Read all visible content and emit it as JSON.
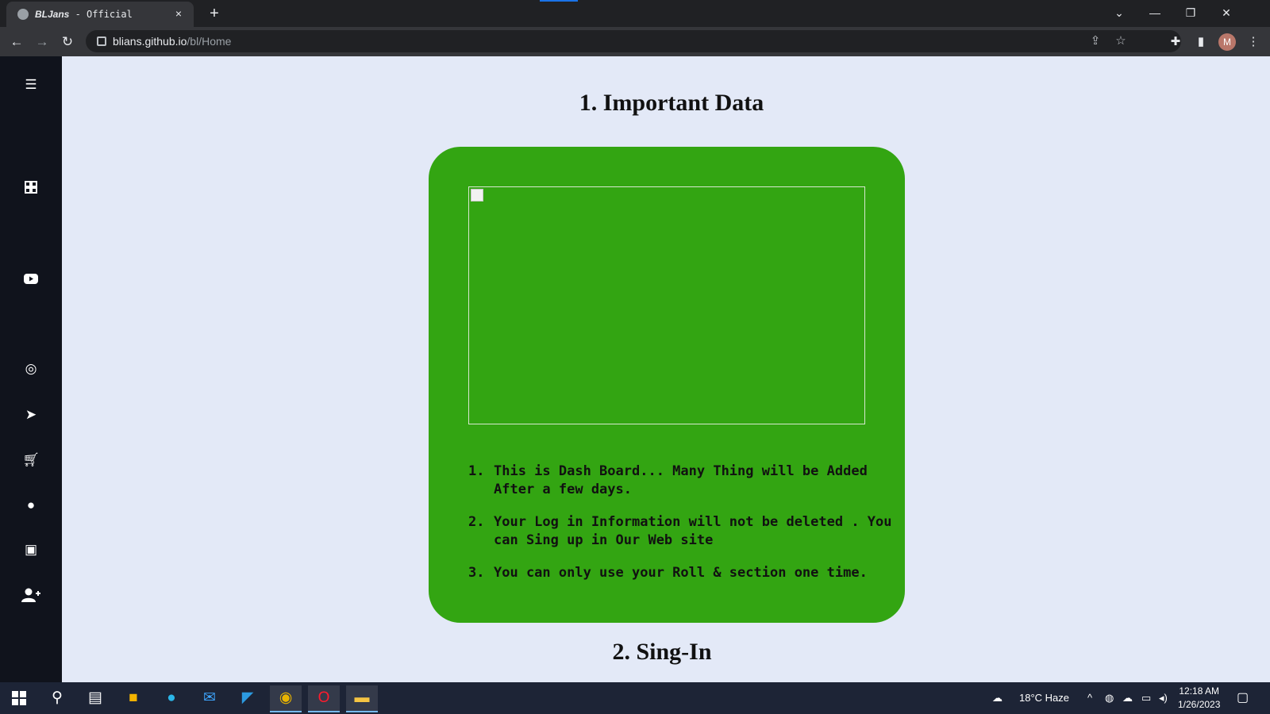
{
  "browser": {
    "tab": {
      "title_bold": "BLJans",
      "title_rest": " - Official",
      "close_label": "×"
    },
    "new_tab_label": "+",
    "url": {
      "host": "blians.github.io",
      "path": "/bl/Home"
    },
    "profile_initial": "M",
    "window_controls": [
      "⌄",
      "—",
      "❐",
      "✕"
    ]
  },
  "sidebar": {
    "icons": [
      "menu-icon",
      "grid-icon",
      "youtube-icon",
      "whatsapp-icon",
      "telegram-icon",
      "cart-icon",
      "bug-icon",
      "contact-icon",
      "add-user-icon"
    ]
  },
  "main": {
    "section1_title": "1. Important Data",
    "notes": [
      {
        "num": "1.",
        "text": "This is Dash Board... Many Thing will be Added After a few days."
      },
      {
        "num": "2.",
        "text": "Your Log in Information will not be deleted . You can Sing up in Our Web site"
      },
      {
        "num": "3.",
        "text": "You can only use your Roll & section one time."
      }
    ],
    "section2_title": "2. Sing-In"
  },
  "taskbar": {
    "weather": "18°C  Haze",
    "time": "12:18 AM",
    "date": "1/26/2023"
  },
  "colors": {
    "card": "#33a512",
    "page_bg": "#e3e9f7",
    "sidebar": "#10131c"
  }
}
